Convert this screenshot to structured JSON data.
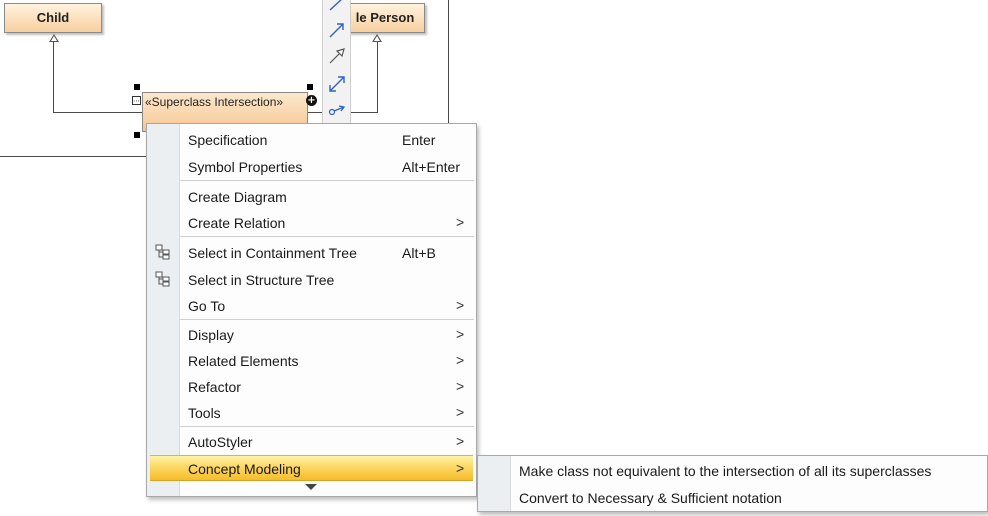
{
  "diagram": {
    "class_child": "Child",
    "class_person": "le Person",
    "selected_shape_label": "«Superclass Intersection»"
  },
  "context_menu": {
    "items": [
      {
        "label": "Specification",
        "shortcut": "Enter"
      },
      {
        "label": "Symbol Properties",
        "shortcut": "Alt+Enter"
      },
      {
        "label": "Create Diagram"
      },
      {
        "label": "Create Relation",
        "submenu_arrow": ">"
      },
      {
        "label": "Select in Containment Tree",
        "shortcut": "Alt+B",
        "icon": "containment-tree-icon"
      },
      {
        "label": "Select in Structure Tree",
        "icon": "structure-tree-icon"
      },
      {
        "label": "Go To",
        "submenu_arrow": ">"
      },
      {
        "label": "Display",
        "submenu_arrow": ">"
      },
      {
        "label": "Related Elements",
        "submenu_arrow": ">"
      },
      {
        "label": "Refactor",
        "submenu_arrow": ">"
      },
      {
        "label": "Tools",
        "submenu_arrow": ">"
      },
      {
        "label": "AutoStyler",
        "submenu_arrow": ">"
      },
      {
        "label": "Concept Modeling",
        "submenu_arrow": ">",
        "highlighted": true
      }
    ]
  },
  "submenu": {
    "items": [
      "Make class not equivalent to the intersection of all its superclasses",
      "Convert to Necessary & Sufficient notation"
    ]
  },
  "toolbar": {
    "icons": [
      "association-icon",
      "directed-association-icon",
      "generalization-icon",
      "dependency-icon",
      "usage-icon"
    ]
  },
  "colors": {
    "highlight": "#fcd35a",
    "class_fill": "#f8cf9e",
    "link_blue": "#2f62c4"
  }
}
